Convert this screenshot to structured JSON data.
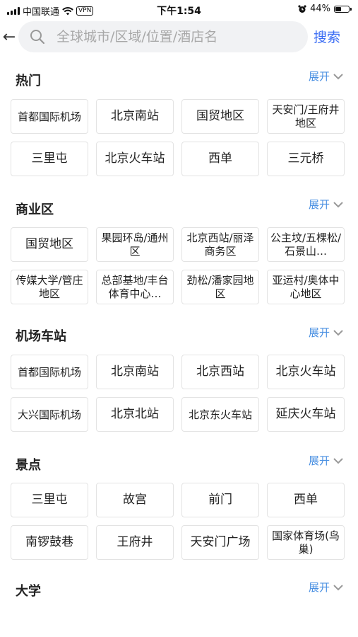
{
  "status_bar": {
    "carrier": "中国联通",
    "vpn": "VPN",
    "time": "下午1:54",
    "battery": "44%",
    "battery_level": 0.44
  },
  "search": {
    "placeholder": "全球城市/区域/位置/酒店名",
    "button": "搜索"
  },
  "expand_label": "展开",
  "sections": [
    {
      "title": "热门",
      "items": [
        "首都国际机场",
        "北京南站",
        "国贸地区",
        "天安门/王府井地区",
        "三里屯",
        "北京火车站",
        "西单",
        "三元桥"
      ]
    },
    {
      "title": "商业区",
      "items": [
        "国贸地区",
        "果园环岛/通州区",
        "北京西站/丽泽商务区",
        "公主坟/五棵松/石景山…",
        "传媒大学/管庄地区",
        "总部基地/丰台体育中心…",
        "劲松/潘家园地区",
        "亚运村/奥体中心地区"
      ]
    },
    {
      "title": "机场车站",
      "items": [
        "首都国际机场",
        "北京南站",
        "北京西站",
        "北京火车站",
        "大兴国际机场",
        "北京北站",
        "北京东火车站",
        "延庆火车站"
      ]
    },
    {
      "title": "景点",
      "items": [
        "三里屯",
        "故宫",
        "前门",
        "西单",
        "南锣鼓巷",
        "王府井",
        "天安门广场",
        "国家体育场(鸟巢)"
      ]
    },
    {
      "title": "大学",
      "items": []
    }
  ]
}
